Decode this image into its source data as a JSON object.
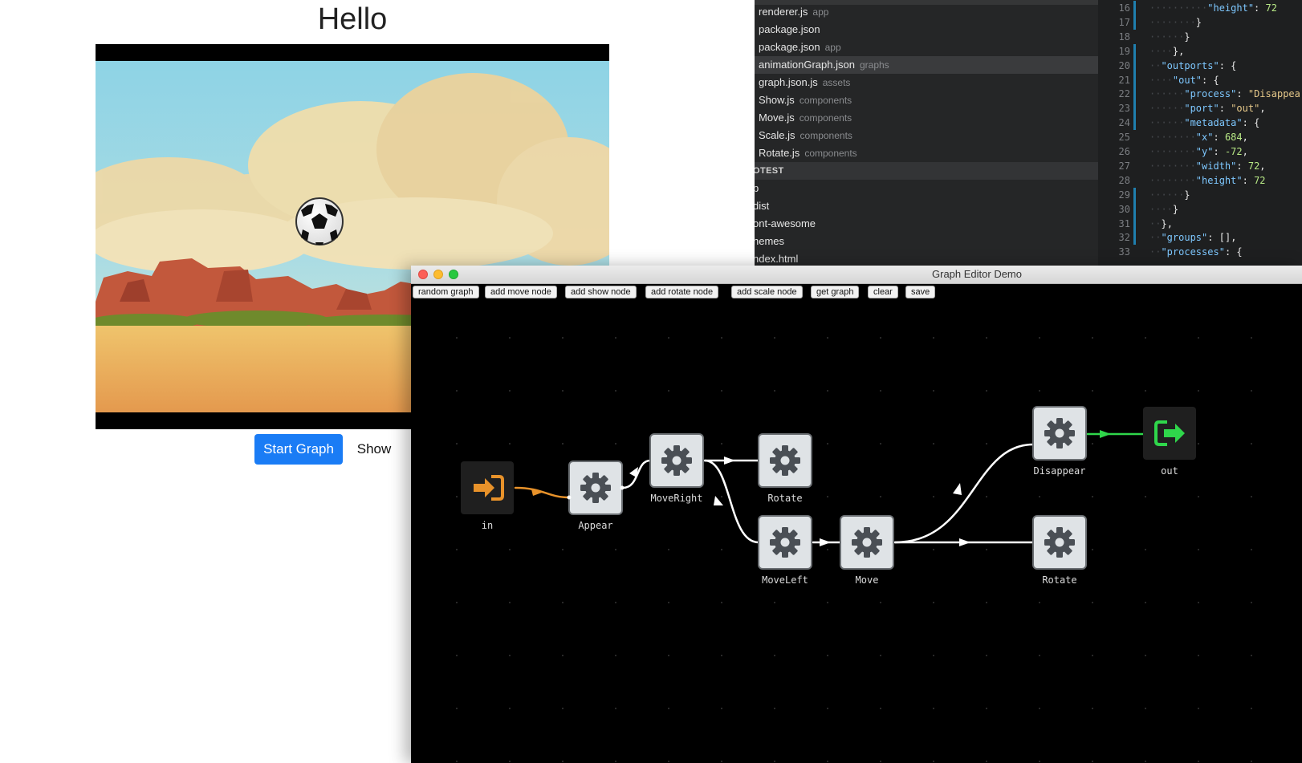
{
  "app": {
    "title": "Hello",
    "start_button": "Start Graph",
    "show_button": "Show"
  },
  "sidebar": {
    "files": [
      {
        "name": "renderer.js",
        "dir": "app"
      },
      {
        "name": "package.json",
        "dir": ""
      },
      {
        "name": "package.json",
        "dir": "app"
      },
      {
        "name": "animationGraph.json",
        "dir": "graphs"
      },
      {
        "name": "graph.json.js",
        "dir": "assets"
      },
      {
        "name": "Show.js",
        "dir": "components"
      },
      {
        "name": "Move.js",
        "dir": "components"
      },
      {
        "name": "Scale.js",
        "dir": "components"
      },
      {
        "name": "Rotate.js",
        "dir": "components"
      }
    ],
    "folder_header": "OTEST",
    "folders": [
      "p",
      "dist",
      "ont-awesome",
      "hemes",
      "ndex.html"
    ]
  },
  "code": {
    "line_numbers": [
      "16",
      "17",
      "18",
      "19",
      "20",
      "21",
      "22",
      "23",
      "24",
      "25",
      "26",
      "27",
      "28",
      "29",
      "30",
      "31",
      "32",
      "33"
    ],
    "lines": [
      "\"height\": 72",
      "}",
      "}",
      "},",
      "\"outports\": {",
      "\"out\": {",
      "\"process\": \"Disappea",
      "\"port\": \"out\",",
      "\"metadata\": {",
      "\"x\": 684,",
      "\"y\": -72,",
      "\"width\": 72,",
      "\"height\": 72",
      "}",
      "}",
      "},",
      "\"groups\": [],",
      "\"processes\": {"
    ]
  },
  "graph_editor": {
    "title": "Graph Editor Demo",
    "toolbar": [
      "random graph",
      "add move node",
      "add show node",
      "add rotate node",
      "add scale node",
      "get graph",
      "clear",
      "save"
    ],
    "nodes": [
      {
        "id": "in",
        "label": "in",
        "kind": "inport",
        "icon": "sign-in-icon"
      },
      {
        "id": "appear",
        "label": "Appear",
        "kind": "process",
        "icon": "gear-icon"
      },
      {
        "id": "moveright",
        "label": "MoveRight",
        "kind": "process",
        "icon": "gear-icon"
      },
      {
        "id": "rotate1",
        "label": "Rotate",
        "kind": "process",
        "icon": "gear-icon"
      },
      {
        "id": "moveleft",
        "label": "MoveLeft",
        "kind": "process",
        "icon": "gear-icon"
      },
      {
        "id": "move",
        "label": "Move",
        "kind": "process",
        "icon": "gear-icon"
      },
      {
        "id": "disappear",
        "label": "Disappear",
        "kind": "process",
        "icon": "gear-icon"
      },
      {
        "id": "rotate2",
        "label": "Rotate",
        "kind": "process",
        "icon": "gear-icon"
      },
      {
        "id": "out",
        "label": "out",
        "kind": "outport",
        "icon": "sign-out-icon"
      }
    ],
    "colors": {
      "inport": "#e8922a",
      "outport": "#2fd64b",
      "edge": "#ffffff",
      "node_fill": "#dfe3e6",
      "gear": "#4a4f55",
      "accent_button": "#1a7cf5"
    }
  }
}
